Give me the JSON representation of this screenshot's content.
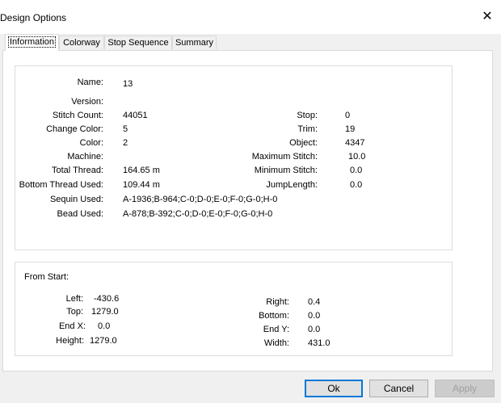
{
  "window": {
    "title": "Design Options"
  },
  "tabs": [
    {
      "label": "Information"
    },
    {
      "label": "Colorway"
    },
    {
      "label": "Stop Sequence"
    },
    {
      "label": "Summary"
    }
  ],
  "info": {
    "name": {
      "label": "Name:",
      "value": "13"
    },
    "version": {
      "label": "Version:",
      "value": ""
    },
    "stitch_count": {
      "label": "Stitch Count:",
      "value": "44051"
    },
    "change_color": {
      "label": "Change Color:",
      "value": "5"
    },
    "color": {
      "label": "Color:",
      "value": "2"
    },
    "machine": {
      "label": "Machine:",
      "value": ""
    },
    "total_thread": {
      "label": "Total Thread:",
      "value": "164.65 m"
    },
    "bottom_thread": {
      "label": "Bottom Thread Used:",
      "value": "109.44 m"
    },
    "sequin_used": {
      "label": "Sequin Used:",
      "value": "A-1936;B-964;C-0;D-0;E-0;F-0;G-0;H-0"
    },
    "bead_used": {
      "label": "Bead Used:",
      "value": "A-878;B-392;C-0;D-0;E-0;F-0;G-0;H-0"
    },
    "stop": {
      "label": "Stop:",
      "value": "0"
    },
    "trim": {
      "label": "Trim:",
      "value": "19"
    },
    "object": {
      "label": "Object:",
      "value": "4347"
    },
    "max_stitch": {
      "label": "Maximum Stitch:",
      "value": "10.0"
    },
    "min_stitch": {
      "label": "Minimum Stitch:",
      "value": "0.0"
    },
    "jump_length": {
      "label": "JumpLength:",
      "value": "0.0"
    }
  },
  "from_start": {
    "heading": "From Start:",
    "left": {
      "label": "Left:",
      "value": "-430.6"
    },
    "top": {
      "label": "Top:",
      "value": "1279.0"
    },
    "end_x": {
      "label": "End X:",
      "value": "0.0"
    },
    "height": {
      "label": "Height:",
      "value": "1279.0"
    },
    "right": {
      "label": "Right:",
      "value": "0.4"
    },
    "bottom": {
      "label": "Bottom:",
      "value": "0.0"
    },
    "end_y": {
      "label": "End Y:",
      "value": "0.0"
    },
    "width": {
      "label": "Width:",
      "value": "431.0"
    }
  },
  "buttons": {
    "ok": "Ok",
    "cancel": "Cancel",
    "apply": "Apply"
  },
  "colors": {
    "accent": "#0078d7",
    "border": "#d9d9d9",
    "dialog_bg": "#f0f0f0"
  }
}
